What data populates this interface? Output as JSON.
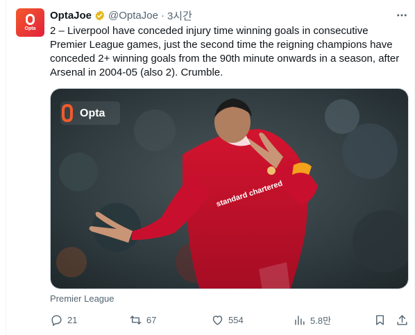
{
  "tweet": {
    "author_name": "OptaJoe",
    "handle": "@OptaJoe",
    "separator": "·",
    "time": "3시간",
    "text": "2 – Liverpool have conceded injury time winning goals in consecutive Premier League games, just the second time the reigning champions have conceded 2+ winning goals from the 90th minute onwards in a season, after Arsenal in 2004-05 (also 2). Crumble.",
    "source_label": "Premier League"
  },
  "avatar": {
    "text": "Opta",
    "colors": [
      "#f25a2b",
      "#e2203c"
    ]
  },
  "media": {
    "watermark": "Opta",
    "jersey_sponsor": "standard chartered",
    "colors": {
      "jersey": "#c8102e",
      "crowd": "#2f3b3f",
      "accent": "#f4a21b"
    }
  },
  "actions": {
    "replies": "21",
    "retweets": "67",
    "likes": "554",
    "views": "5.8만"
  },
  "icons": [
    "verified-badge-icon",
    "more-icon",
    "reply-icon",
    "retweet-icon",
    "like-icon",
    "views-icon",
    "bookmark-icon",
    "share-icon"
  ]
}
